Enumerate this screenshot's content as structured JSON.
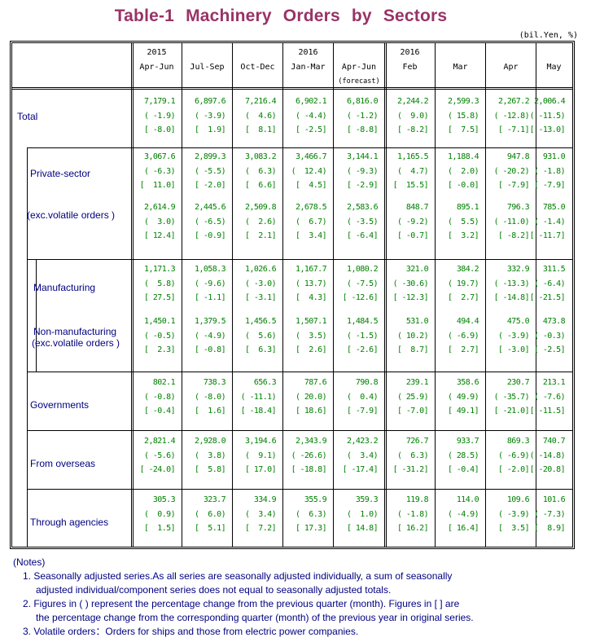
{
  "title": "Table-1  Machinery  Orders  by  Sectors",
  "unit": "(bil.Yen, %)",
  "columns": [
    {
      "year": "2015",
      "period": "Apr-Jun",
      "note": ""
    },
    {
      "year": "",
      "period": "Jul-Sep",
      "note": ""
    },
    {
      "year": "",
      "period": "Oct-Dec",
      "note": ""
    },
    {
      "year": "2016",
      "period": "Jan-Mar",
      "note": ""
    },
    {
      "year": "",
      "period": "Apr-Jun",
      "note": "(forecast)"
    },
    {
      "year": "2016",
      "period": "Feb",
      "note": ""
    },
    {
      "year": "",
      "period": "Mar",
      "note": ""
    },
    {
      "year": "",
      "period": "Apr",
      "note": ""
    },
    {
      "year": "",
      "period": "May",
      "note": ""
    }
  ],
  "rows": [
    {
      "label": "Total",
      "label2": "",
      "values": [
        [
          "7,179.1",
          "( -1.9)",
          "[ -8.0]"
        ],
        [
          "6,897.6",
          "( -3.9)",
          "[  1.9]"
        ],
        [
          "7,216.4",
          "(  4.6)",
          "[  8.1]"
        ],
        [
          "6,902.1",
          "( -4.4)",
          "[ -2.5]"
        ],
        [
          "6,816.0",
          "( -1.2)",
          "[ -8.8]"
        ],
        [
          "2,244.2",
          "(  9.0)",
          "[ -8.2]"
        ],
        [
          "2,599.3",
          "( 15.8)",
          "[  7.5]"
        ],
        [
          "2,267.2",
          "( -12.8)",
          "[ -7.1]"
        ],
        [
          "2,006.4",
          "( -11.5)",
          "[ -13.0]"
        ]
      ]
    },
    {
      "label": "Private-sector",
      "label2": "",
      "values": [
        [
          "3,067.6",
          "( -6.3)",
          "[  11.0]"
        ],
        [
          "2,899.3",
          "( -5.5)",
          "[ -2.0]"
        ],
        [
          "3,083.2",
          "(  6.3)",
          "[  6.6]"
        ],
        [
          "3,466.7",
          "(  12.4)",
          "[  4.5]"
        ],
        [
          "3,144.1",
          "( -9.3)",
          "[ -2.9]"
        ],
        [
          "1,165.5",
          "(  4.7)",
          "[  15.5]"
        ],
        [
          "1,188.4",
          "(  2.0)",
          "[ -0.0]"
        ],
        [
          "947.8",
          "( -20.2)",
          "[ -7.9]"
        ],
        [
          "931.0",
          "( -1.8)",
          "[ -7.9]"
        ]
      ]
    },
    {
      "label": "(exc.volatile orders )",
      "label2": "",
      "values": [
        [
          "2,614.9",
          "(  3.0)",
          "[ 12.4]"
        ],
        [
          "2,445.6",
          "( -6.5)",
          "[ -0.9]"
        ],
        [
          "2,509.8",
          "(  2.6)",
          "[  2.1]"
        ],
        [
          "2,678.5",
          "(  6.7)",
          "[  3.4]"
        ],
        [
          "2,583.6",
          "( -3.5)",
          "[ -6.4]"
        ],
        [
          "848.7",
          "( -9.2)",
          "[ -0.7]"
        ],
        [
          "895.1",
          "(  5.5)",
          "[  3.2]"
        ],
        [
          "796.3",
          "( -11.0)",
          "[ -8.2]"
        ],
        [
          "785.0",
          "( -1.4)",
          "[ -11.7]"
        ]
      ]
    },
    {
      "label": "Manufacturing",
      "label2": "",
      "values": [
        [
          "1,171.3",
          "(  5.8)",
          "[ 27.5]"
        ],
        [
          "1,058.3",
          "( -9.6)",
          "[ -1.1]"
        ],
        [
          "1,026.6",
          "( -3.0)",
          "[ -3.1]"
        ],
        [
          "1,167.7",
          "( 13.7)",
          "[  4.3]"
        ],
        [
          "1,080.2",
          "( -7.5)",
          "[ -12.6]"
        ],
        [
          "321.0",
          "( -30.6)",
          "[ -12.3]"
        ],
        [
          "384.2",
          "( 19.7)",
          "[  2.7]"
        ],
        [
          "332.9",
          "( -13.3)",
          "[ -14.8]"
        ],
        [
          "311.5",
          "( -6.4)",
          "[ -21.5]"
        ]
      ]
    },
    {
      "label": "Non-manufacturing",
      "label2": "(exc.volatile orders )",
      "values": [
        [
          "1,450.1",
          "( -0.5)",
          "[  2.3]"
        ],
        [
          "1,379.5",
          "( -4.9)",
          "[ -0.8]"
        ],
        [
          "1,456.5",
          "(  5.6)",
          "[  6.3]"
        ],
        [
          "1,507.1",
          "(  3.5)",
          "[  2.6]"
        ],
        [
          "1,484.5",
          "( -1.5)",
          "[ -2.6]"
        ],
        [
          "531.0",
          "( 10.2)",
          "[  8.7]"
        ],
        [
          "494.4",
          "( -6.9)",
          "[  2.7]"
        ],
        [
          "475.0",
          "( -3.9)",
          "[ -3.0]"
        ],
        [
          "473.8",
          "( -0.3)",
          "[ -2.5]"
        ]
      ]
    },
    {
      "label": "Governments",
      "label2": "",
      "values": [
        [
          "802.1",
          "( -0.8)",
          "[ -0.4]"
        ],
        [
          "738.3",
          "( -8.0)",
          "[  1.6]"
        ],
        [
          "656.3",
          "( -11.1)",
          "[ -18.4]"
        ],
        [
          "787.6",
          "( 20.0)",
          "[ 18.6]"
        ],
        [
          "790.8",
          "(  0.4)",
          "[ -7.9]"
        ],
        [
          "239.1",
          "( 25.9)",
          "[ -7.0]"
        ],
        [
          "358.6",
          "( 49.9)",
          "[ 49.1]"
        ],
        [
          "230.7",
          "( -35.7)",
          "[ -21.0]"
        ],
        [
          "213.1",
          "( -7.6)",
          "[ -11.5]"
        ]
      ]
    },
    {
      "label": "From overseas",
      "label2": "",
      "values": [
        [
          "2,821.4",
          "( -5.6)",
          "[ -24.0]"
        ],
        [
          "2,928.0",
          "(  3.8)",
          "[  5.8]"
        ],
        [
          "3,194.6",
          "(  9.1)",
          "[ 17.0]"
        ],
        [
          "2,343.9",
          "( -26.6)",
          "[ -18.8]"
        ],
        [
          "2,423.2",
          "(  3.4)",
          "[ -17.4]"
        ],
        [
          "726.7",
          "(  6.3)",
          "[ -31.2]"
        ],
        [
          "933.7",
          "( 28.5)",
          "[ -0.4]"
        ],
        [
          "869.3",
          "( -6.9)",
          "[ -2.0]"
        ],
        [
          "740.7",
          "( -14.8)",
          "[ -20.8]"
        ]
      ]
    },
    {
      "label": "Through agencies",
      "label2": "",
      "values": [
        [
          "305.3",
          "(  0.9)",
          "[  1.5]"
        ],
        [
          "323.7",
          "(  6.0)",
          "[  5.1]"
        ],
        [
          "334.9",
          "(  3.4)",
          "[  7.2]"
        ],
        [
          "355.9",
          "(  6.3)",
          "[ 17.3]"
        ],
        [
          "359.3",
          "(  1.0)",
          "[ 14.8]"
        ],
        [
          "119.8",
          "( -1.8)",
          "[ 16.2]"
        ],
        [
          "114.0",
          "( -4.9)",
          "[ 16.4]"
        ],
        [
          "109.6",
          "( -3.9)",
          "[  3.5]"
        ],
        [
          "101.6",
          "( -7.3)",
          "[  8.9]"
        ]
      ]
    }
  ],
  "notes": {
    "heading": "(Notes)",
    "items": [
      {
        "text": "1. Seasonally adjusted series.As all series are seasonally adjusted individually, a sum of seasonally",
        "cont": "adjusted individual/component series does not equal to seasonally adjusted totals."
      },
      {
        "text": "2. Figures in ( ) represent the percentage change from the previous quarter (month). Figures in [ ] are",
        "cont": "the percentage change from the corresponding quarter (month) of the previous year in original series."
      },
      {
        "text": "3. Volatile orders：Orders for ships and those from electric power companies.",
        "cont": ""
      }
    ]
  },
  "colors": {
    "title": "#993366",
    "label": "#000080",
    "value": "#008000"
  }
}
